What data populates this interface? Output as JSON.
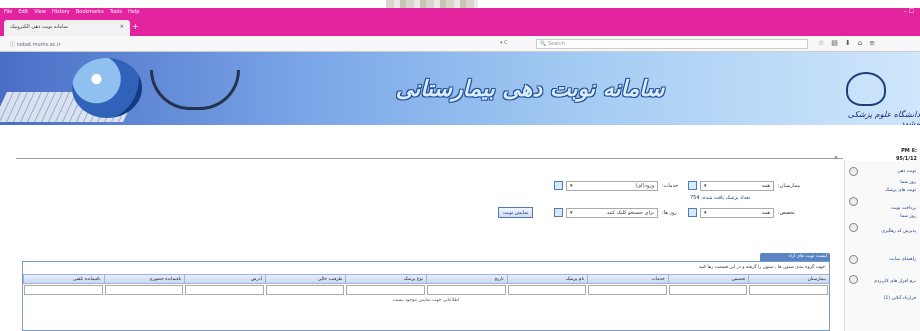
{
  "browser": {
    "menu": [
      "File",
      "Edit",
      "View",
      "History",
      "Bookmarks",
      "Tools",
      "Help"
    ],
    "window_controls": "–  ☐",
    "tab_title": "سامانه نوبت دهی الکترونیک",
    "tab_close": "×",
    "new_tab": "+",
    "url": "ⓘ  nobat.mums.ac.ir",
    "reload": "▾ C",
    "search_placeholder": "Search",
    "toolbar_icons": [
      "☆",
      "▤",
      "⬇",
      "⌂",
      "≡"
    ]
  },
  "banner": {
    "title": "سامانه نوبت دهی بیمارستانی",
    "university": "دانشگاه علوم پزشکی مشهد"
  },
  "content": {
    "close": "×"
  },
  "sidebar": {
    "time": "PM 6:",
    "date": "95/1/12",
    "items": [
      "نوبت دهی",
      "روز شما",
      "نوبت های پزشک",
      "پرداخت نوبت",
      "روز شما",
      "پذیرش کد رهگیری",
      "راهنمای سایت",
      "نرم افزار های کاربردی",
      "قرارداد آنلاین (1)"
    ]
  },
  "form": {
    "hospital_label": "بیمارستان:",
    "hospital_value": "همه",
    "clinic_label": "خدمات:",
    "clinic_value": "ورود(ای)",
    "doctor_count_text": "تعداد پزشک یافت شده: 754",
    "expertise_label": "تخصص:",
    "expertise_value": "همه",
    "day_label": "روز ها:",
    "day_value": "برای جستجو کلیک کنید",
    "show_button": "نمایش نوبت"
  },
  "grid": {
    "tab_label": "لیست نوبت های آزاد",
    "info_text": "جهت گروه بندی ستون ها ، ستون را گرفته و در این قسمت رها کنید",
    "columns": [
      "بیمارستان",
      "تخصص",
      "خدمات",
      "نام پزشک",
      "تاریخ",
      "نوع پزشک",
      "ظرفیت خالی",
      "آدرس",
      "باقیمانده حضوری",
      "باقیمانده تلفنی"
    ],
    "empty_message": "اطلاعاتی جهت نمایش موجود نیست"
  }
}
